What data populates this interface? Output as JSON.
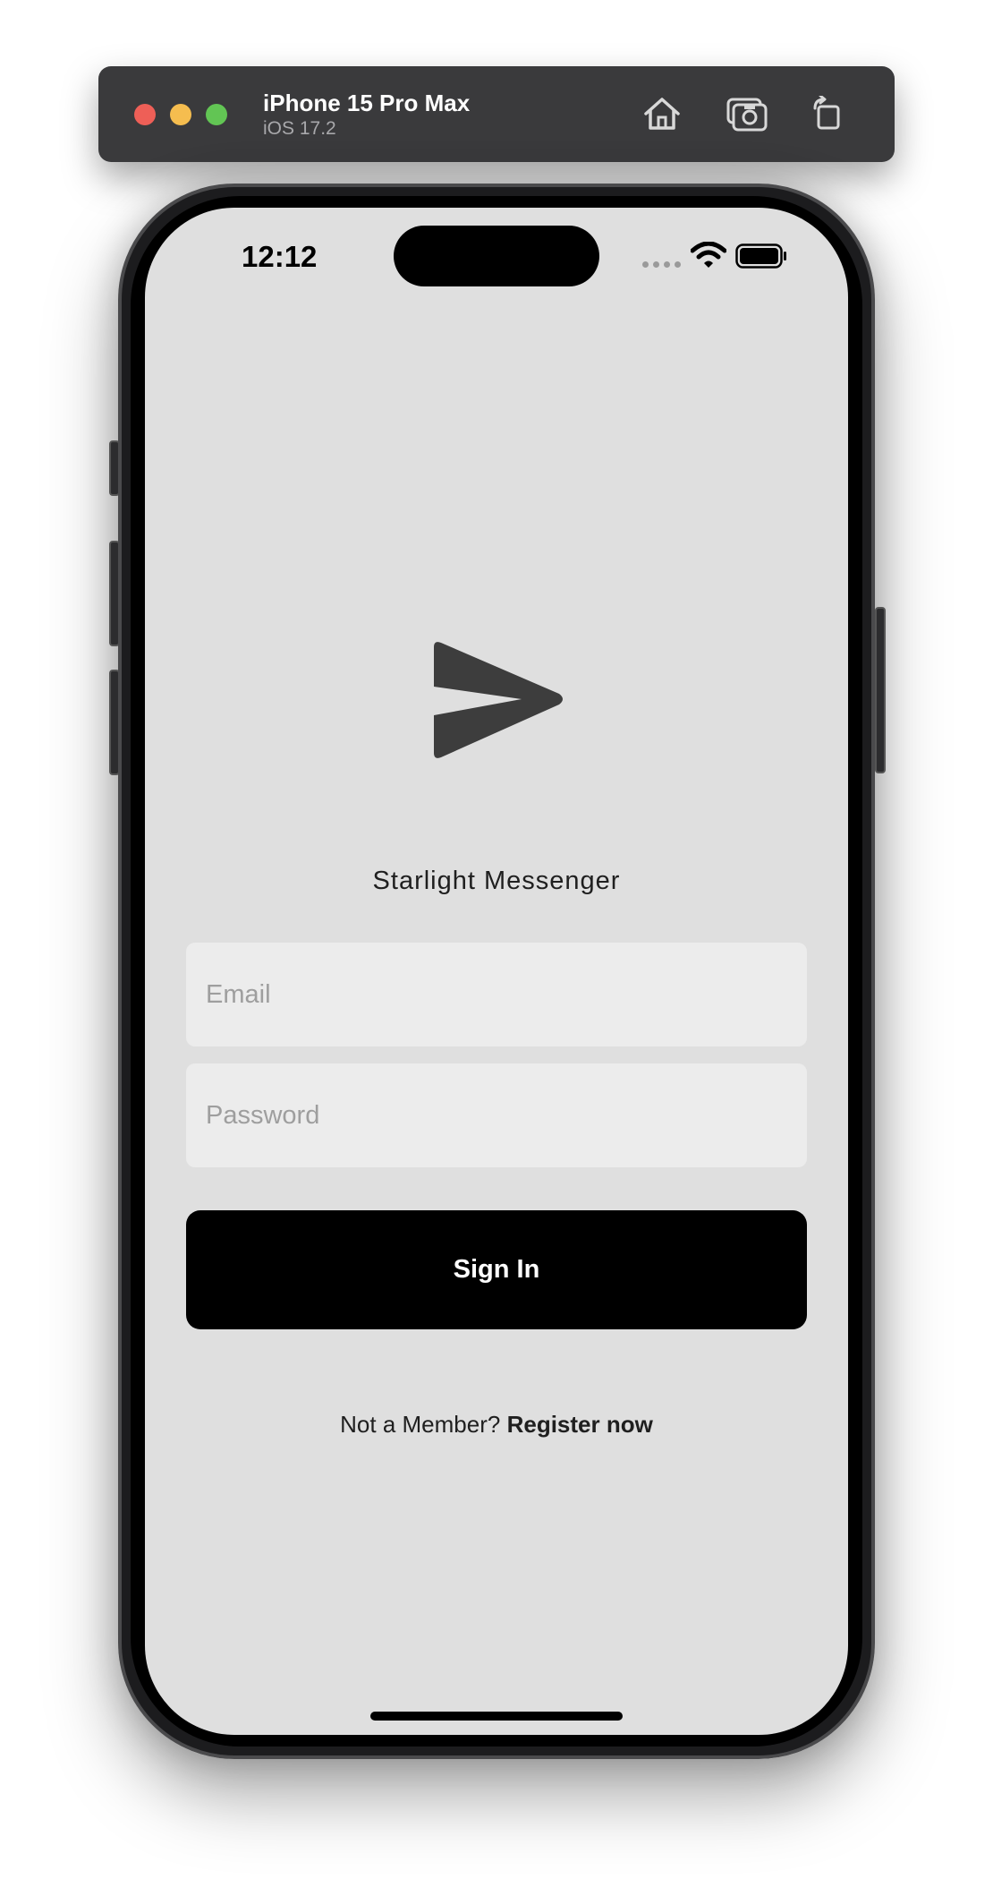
{
  "simulator": {
    "device_name": "iPhone 15 Pro Max",
    "os_version": "iOS 17.2",
    "icons": [
      "home-icon",
      "screenshot-icon",
      "rotate-icon"
    ]
  },
  "status_bar": {
    "time": "12:12",
    "icons": [
      "cellular-signal-icon",
      "wifi-icon",
      "battery-icon"
    ]
  },
  "app": {
    "logo_icon": "paper-plane-icon",
    "title": "Starlight Messenger",
    "email_placeholder": "Email",
    "password_placeholder": "Password",
    "sign_in_label": "Sign In",
    "register_prompt": "Not a Member?",
    "register_link": "Register now"
  },
  "colors": {
    "screen_background": "#dfdfdf",
    "field_background": "#ececec",
    "button_background": "#000000",
    "logo": "#3d3d3d"
  }
}
